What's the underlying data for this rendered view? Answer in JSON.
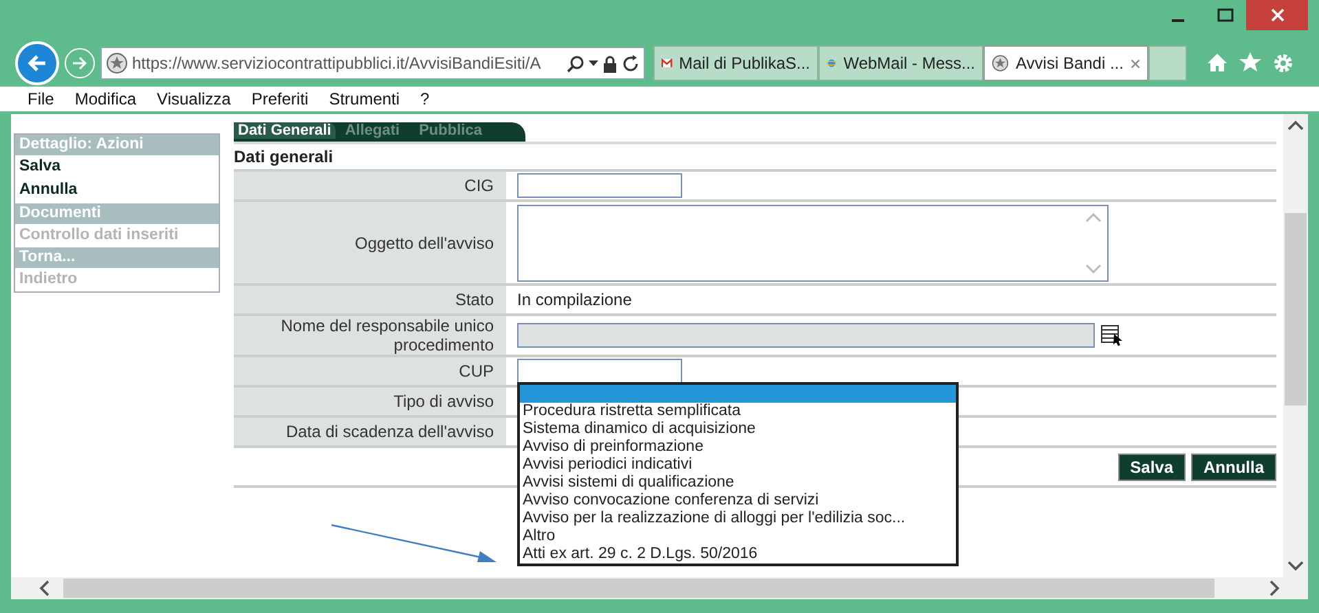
{
  "browser": {
    "address": "https://www.serviziocontrattipubblici.it/AvvisiBandiEsiti/A",
    "tabs": [
      {
        "title": "Mail di PublikaS...",
        "kind": "mail",
        "selected": false
      },
      {
        "title": "WebMail - Mess...",
        "kind": "web",
        "selected": false
      },
      {
        "title": "Avvisi Bandi ...",
        "kind": "emblem",
        "selected": true
      }
    ],
    "menu": [
      "File",
      "Modifica",
      "Visualizza",
      "Preferiti",
      "Strumenti",
      "?"
    ]
  },
  "sidebar": [
    {
      "title": "Dettaglio: Azioni",
      "items": [
        {
          "label": "Salva",
          "disabled": false
        },
        {
          "label": "Annulla",
          "disabled": false
        }
      ]
    },
    {
      "title": "Documenti",
      "items": [
        {
          "label": "Controllo dati inseriti",
          "disabled": true
        }
      ]
    },
    {
      "title": "Torna...",
      "items": [
        {
          "label": "Indietro",
          "disabled": true
        }
      ]
    }
  ],
  "page_tabs": [
    {
      "label": "Dati Generali",
      "selected": true
    },
    {
      "label": "Allegati",
      "selected": false
    },
    {
      "label": "Pubblica",
      "selected": false
    }
  ],
  "section_title": "Dati generali",
  "fields": [
    {
      "label": "CIG",
      "kind": "text"
    },
    {
      "label": "Oggetto dell'avviso",
      "kind": "textarea"
    },
    {
      "label": "Stato",
      "kind": "static",
      "value": "In compilazione"
    },
    {
      "label": "Nome del responsabile unico procedimento",
      "kind": "lookup"
    },
    {
      "label": "CUP",
      "kind": "text"
    },
    {
      "label": "Tipo di avviso",
      "kind": "select"
    },
    {
      "label": "Data di scadenza dell'avviso",
      "kind": "hidden"
    }
  ],
  "dropdown": [
    {
      "selected": true
    },
    {
      "label": "Procedura ristretta semplificata",
      "selected": false
    },
    {
      "label": "Sistema dinamico di acquisizione",
      "selected": false
    },
    {
      "label": "Avviso di preinformazione",
      "selected": false
    },
    {
      "label": "Avvisi periodici indicativi",
      "selected": false
    },
    {
      "label": "Avvisi sistemi di qualificazione",
      "selected": false
    },
    {
      "label": "Avviso convocazione conferenza di servizi",
      "selected": false
    },
    {
      "label": "Avviso per la realizzazione di alloggi per l'edilizia soc...",
      "selected": false
    },
    {
      "label": "Altro",
      "selected": false
    },
    {
      "label": "Atti ex art. 29 c. 2 D.Lgs. 50/2016",
      "selected": false
    }
  ],
  "buttons": [
    "Salva",
    "Annulla"
  ]
}
